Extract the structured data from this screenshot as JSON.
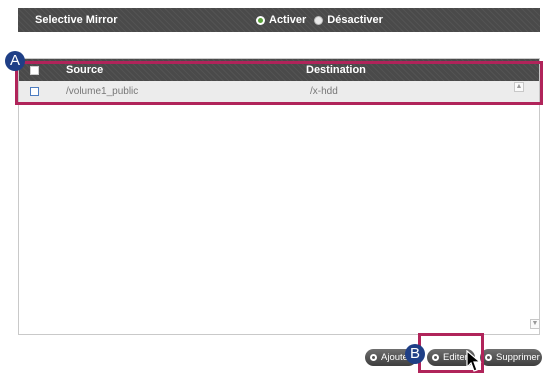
{
  "header": {
    "title": "Selective Mirror",
    "mode_options": [
      {
        "label": "Activer",
        "selected": true
      },
      {
        "label": "Désactiver",
        "selected": false
      }
    ]
  },
  "table": {
    "columns": [
      "Source",
      "Destination"
    ],
    "rows": [
      {
        "source": "/volume1_public",
        "destination": "/x-hdd",
        "checked": false
      }
    ]
  },
  "buttons": {
    "add": "Ajouter",
    "edit": "Editer",
    "delete": "Supprimer"
  },
  "callouts": {
    "a": "A",
    "b": "B"
  },
  "colors": {
    "highlight": "#b0245a",
    "marker": "#1f3f86",
    "radio_selected": "#5aa23a"
  }
}
